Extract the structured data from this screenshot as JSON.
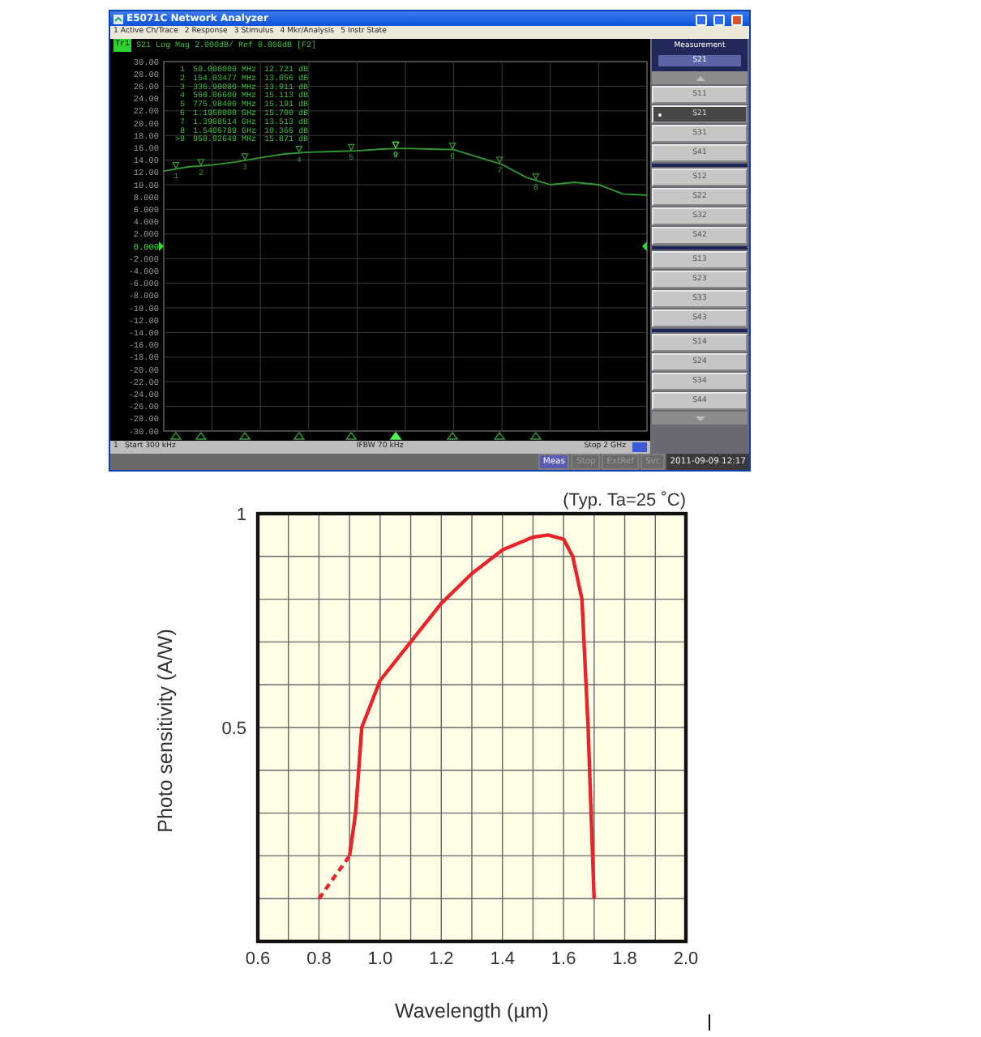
{
  "analyzer": {
    "window": {
      "title": "E5071C Network Analyzer"
    },
    "menu": [
      "1 Active Ch/Trace",
      "2 Response",
      "3 Stimulus",
      "4 Mkr/Analysis",
      "5 Instr State"
    ],
    "trace_header": {
      "badge": "Tr1",
      "text": "S21 Log Mag 2.000dB/ Ref 0.000dB [F2]"
    },
    "markers": [
      {
        "number": "1",
        "stimulus": "50.000000 MHz",
        "response": "12.721 dB"
      },
      {
        "number": "2",
        "stimulus": "154.03477 MHz",
        "response": "13.056 dB"
      },
      {
        "number": "3",
        "stimulus": "336.90080 MHz",
        "response": "13.911 dB"
      },
      {
        "number": "4",
        "stimulus": "560.06600 MHz",
        "response": "15.113 dB"
      },
      {
        "number": "5",
        "stimulus": "775.98400 MHz",
        "response": "15.191 dB"
      },
      {
        "number": "6",
        "stimulus": "1.1950000 GHz",
        "response": "15.700 dB"
      },
      {
        "number": "7",
        "stimulus": "1.3908514 GHz",
        "response": "13.513 dB"
      },
      {
        "number": "8",
        "stimulus": "1.5406789 GHz",
        "response": "10.366 dB"
      },
      {
        "number": ">9",
        "stimulus": "958.92649 MHz",
        "response": "15.871 dB"
      }
    ],
    "chart_data": {
      "type": "line",
      "grid": true,
      "categories": [
        null,
        null,
        null,
        null,
        null,
        null,
        null,
        null,
        null,
        null,
        null,
        null,
        null,
        null,
        null,
        null,
        null,
        null,
        null,
        null,
        null
      ],
      "series": [
        {
          "color": "#2f9a2f",
          "values": [
            12.2,
            12.9,
            13.2,
            13.7,
            14.4,
            15.0,
            15.3,
            15.4,
            15.5,
            15.8,
            15.9,
            15.8,
            15.7,
            14.5,
            13.3,
            11.2,
            10.0,
            10.4,
            10.0,
            8.5,
            8.3
          ]
        }
      ],
      "ylim": [
        -30,
        30
      ],
      "yticks": [
        {
          "value": 30,
          "label": "30.00"
        },
        {
          "value": 28,
          "label": "28.00"
        },
        {
          "value": 26,
          "label": "26.00"
        },
        {
          "value": 24,
          "label": "24.00"
        },
        {
          "value": 22,
          "label": "22.00"
        },
        {
          "value": 20,
          "label": "20.00"
        },
        {
          "value": 18,
          "label": "18.00"
        },
        {
          "value": 16,
          "label": "16.00"
        },
        {
          "value": 14,
          "label": "14.00"
        },
        {
          "value": 12,
          "label": "12.00"
        },
        {
          "value": 10,
          "label": "10.00"
        },
        {
          "value": 8,
          "label": "8.000"
        },
        {
          "value": 6,
          "label": "6.000"
        },
        {
          "value": 4,
          "label": "4.000"
        },
        {
          "value": 2,
          "label": "2.000"
        },
        {
          "value": 0,
          "label": "0.000"
        },
        {
          "value": -2,
          "label": "-2.000"
        },
        {
          "value": -4,
          "label": "-4.000"
        },
        {
          "value": -6,
          "label": "-6.000"
        },
        {
          "value": -8,
          "label": "-8.000"
        },
        {
          "value": -10,
          "label": "-10.00"
        },
        {
          "value": -12,
          "label": "-12.00"
        },
        {
          "value": -14,
          "label": "-14.00"
        },
        {
          "value": -16,
          "label": "-16.00"
        },
        {
          "value": -18,
          "label": "-18.00"
        },
        {
          "value": -20,
          "label": "-20.00"
        },
        {
          "value": -22,
          "label": "-22.00"
        },
        {
          "value": -24,
          "label": "-24.00"
        },
        {
          "value": -26,
          "label": "-26.00"
        },
        {
          "value": -28,
          "label": "-28.00"
        },
        {
          "value": -30,
          "label": "-30.00"
        }
      ]
    },
    "trace_markers": [
      {
        "label": "1",
        "active": false
      },
      {
        "label": "2",
        "active": false
      },
      {
        "label": "3",
        "active": false
      },
      {
        "label": "4",
        "active": false
      },
      {
        "label": "5",
        "active": false
      },
      {
        "label": "6",
        "active": false
      },
      {
        "label": "7",
        "active": false
      },
      {
        "label": "8",
        "active": false
      },
      {
        "label": "9",
        "active": true
      }
    ],
    "stimulus": {
      "channel": "1",
      "start": "Start 300 kHz",
      "ifbw": "IFBW 70 kHz",
      "stop": "Stop 2 GHz"
    },
    "panel": {
      "title": "Measurement",
      "value": "S21",
      "groups": [
        [
          {
            "label": "S11",
            "selected": false
          },
          {
            "label": "S21",
            "selected": true
          },
          {
            "label": "S31",
            "selected": false
          },
          {
            "label": "S41",
            "selected": false
          }
        ],
        [
          {
            "label": "S12",
            "selected": false
          },
          {
            "label": "S22",
            "selected": false
          },
          {
            "label": "S32",
            "selected": false
          },
          {
            "label": "S42",
            "selected": false
          }
        ],
        [
          {
            "label": "S13",
            "selected": false
          },
          {
            "label": "S23",
            "selected": false
          },
          {
            "label": "S33",
            "selected": false
          },
          {
            "label": "S43",
            "selected": false
          }
        ],
        [
          {
            "label": "S14",
            "selected": false
          },
          {
            "label": "S24",
            "selected": false
          },
          {
            "label": "S34",
            "selected": false
          },
          {
            "label": "S44",
            "selected": false
          }
        ]
      ]
    },
    "status": {
      "indicators": [
        {
          "label": "Meas",
          "on": true
        },
        {
          "label": "Stop",
          "on": false
        },
        {
          "label": "ExtRef",
          "on": false
        },
        {
          "label": "Svc",
          "on": false
        }
      ],
      "datetime": "2011-09-09 12:17"
    }
  },
  "sensitivity_chart": {
    "chart_data": {
      "type": "line",
      "grid": true,
      "xlabel": "Wavelength (µm)",
      "ylabel": "Photo sensitivity (A/W)",
      "x": [
        0.8,
        0.85,
        0.9,
        0.92,
        0.94,
        1.0,
        1.1,
        1.2,
        1.3,
        1.4,
        1.5,
        1.55,
        1.6,
        1.63,
        1.66,
        1.68,
        1.7
      ],
      "series": [
        {
          "color": "#e8232a",
          "line_style": "dashed",
          "values": [
            0.1,
            0.15,
            0.2,
            null,
            null,
            null,
            null,
            null,
            null,
            null,
            null,
            null,
            null,
            null,
            null,
            null,
            null
          ]
        },
        {
          "color": "#e8232a",
          "line_style": "solid",
          "values": [
            null,
            null,
            0.2,
            0.3,
            0.5,
            0.61,
            0.7,
            0.79,
            0.86,
            0.915,
            0.945,
            0.95,
            0.94,
            0.9,
            0.8,
            0.5,
            0.1
          ]
        }
      ],
      "xlim": [
        0.6,
        2.0
      ],
      "ylim": [
        0,
        1
      ],
      "xticks": [
        {
          "value": 0.6,
          "label": "0.6"
        },
        {
          "value": 0.8,
          "label": "0.8"
        },
        {
          "value": 1.0,
          "label": "1.0"
        },
        {
          "value": 1.2,
          "label": "1.2"
        },
        {
          "value": 1.4,
          "label": "1.4"
        },
        {
          "value": 1.6,
          "label": "1.6"
        },
        {
          "value": 1.8,
          "label": "1.8"
        },
        {
          "value": 2.0,
          "label": "2.0"
        }
      ],
      "yticks": [
        {
          "value": 0.5,
          "label": "0.5"
        },
        {
          "value": 1,
          "label": "1"
        }
      ],
      "annotations": [
        {
          "text": "(Typ. Ta=25 ˚C)"
        }
      ]
    }
  }
}
